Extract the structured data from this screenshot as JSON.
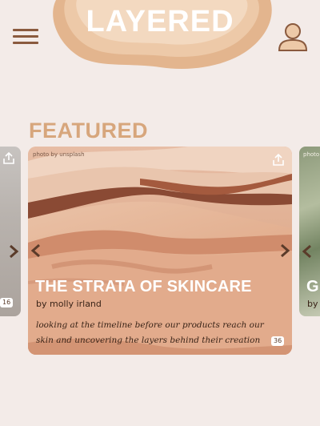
{
  "app": {
    "brand": "LAYERED"
  },
  "header": {
    "menu_icon": "hamburger-icon",
    "profile_icon": "user-icon"
  },
  "section": {
    "title": "FEATURED"
  },
  "carousel": {
    "current": {
      "credit": "photo by unsplash",
      "title": "THE STRATA OF SKINCARE",
      "author": "by molly irland",
      "description": "looking at the timeline before our products reach our skin and uncovering the layers behind their creation",
      "count": "36"
    },
    "prev": {
      "count": "16"
    },
    "next": {
      "credit": "photo b",
      "title_fragment": "G",
      "author_fragment": "by"
    }
  },
  "colors": {
    "background": "#f3ebe8",
    "accent": "#d7a67c",
    "icon_brown": "#8a5a3e"
  }
}
